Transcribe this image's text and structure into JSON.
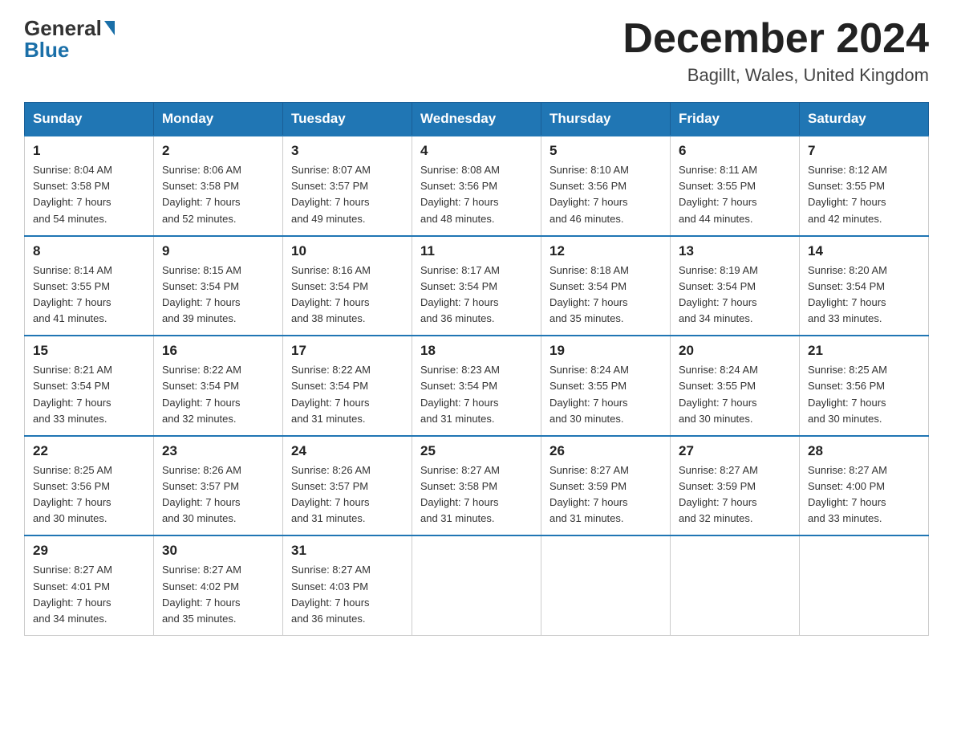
{
  "header": {
    "logo_general": "General",
    "logo_blue": "Blue",
    "title": "December 2024",
    "subtitle": "Bagillt, Wales, United Kingdom"
  },
  "weekdays": [
    "Sunday",
    "Monday",
    "Tuesday",
    "Wednesday",
    "Thursday",
    "Friday",
    "Saturday"
  ],
  "weeks": [
    [
      {
        "day": "1",
        "sunrise": "8:04 AM",
        "sunset": "3:58 PM",
        "daylight": "7 hours and 54 minutes."
      },
      {
        "day": "2",
        "sunrise": "8:06 AM",
        "sunset": "3:58 PM",
        "daylight": "7 hours and 52 minutes."
      },
      {
        "day": "3",
        "sunrise": "8:07 AM",
        "sunset": "3:57 PM",
        "daylight": "7 hours and 49 minutes."
      },
      {
        "day": "4",
        "sunrise": "8:08 AM",
        "sunset": "3:56 PM",
        "daylight": "7 hours and 48 minutes."
      },
      {
        "day": "5",
        "sunrise": "8:10 AM",
        "sunset": "3:56 PM",
        "daylight": "7 hours and 46 minutes."
      },
      {
        "day": "6",
        "sunrise": "8:11 AM",
        "sunset": "3:55 PM",
        "daylight": "7 hours and 44 minutes."
      },
      {
        "day": "7",
        "sunrise": "8:12 AM",
        "sunset": "3:55 PM",
        "daylight": "7 hours and 42 minutes."
      }
    ],
    [
      {
        "day": "8",
        "sunrise": "8:14 AM",
        "sunset": "3:55 PM",
        "daylight": "7 hours and 41 minutes."
      },
      {
        "day": "9",
        "sunrise": "8:15 AM",
        "sunset": "3:54 PM",
        "daylight": "7 hours and 39 minutes."
      },
      {
        "day": "10",
        "sunrise": "8:16 AM",
        "sunset": "3:54 PM",
        "daylight": "7 hours and 38 minutes."
      },
      {
        "day": "11",
        "sunrise": "8:17 AM",
        "sunset": "3:54 PM",
        "daylight": "7 hours and 36 minutes."
      },
      {
        "day": "12",
        "sunrise": "8:18 AM",
        "sunset": "3:54 PM",
        "daylight": "7 hours and 35 minutes."
      },
      {
        "day": "13",
        "sunrise": "8:19 AM",
        "sunset": "3:54 PM",
        "daylight": "7 hours and 34 minutes."
      },
      {
        "day": "14",
        "sunrise": "8:20 AM",
        "sunset": "3:54 PM",
        "daylight": "7 hours and 33 minutes."
      }
    ],
    [
      {
        "day": "15",
        "sunrise": "8:21 AM",
        "sunset": "3:54 PM",
        "daylight": "7 hours and 33 minutes."
      },
      {
        "day": "16",
        "sunrise": "8:22 AM",
        "sunset": "3:54 PM",
        "daylight": "7 hours and 32 minutes."
      },
      {
        "day": "17",
        "sunrise": "8:22 AM",
        "sunset": "3:54 PM",
        "daylight": "7 hours and 31 minutes."
      },
      {
        "day": "18",
        "sunrise": "8:23 AM",
        "sunset": "3:54 PM",
        "daylight": "7 hours and 31 minutes."
      },
      {
        "day": "19",
        "sunrise": "8:24 AM",
        "sunset": "3:55 PM",
        "daylight": "7 hours and 30 minutes."
      },
      {
        "day": "20",
        "sunrise": "8:24 AM",
        "sunset": "3:55 PM",
        "daylight": "7 hours and 30 minutes."
      },
      {
        "day": "21",
        "sunrise": "8:25 AM",
        "sunset": "3:56 PM",
        "daylight": "7 hours and 30 minutes."
      }
    ],
    [
      {
        "day": "22",
        "sunrise": "8:25 AM",
        "sunset": "3:56 PM",
        "daylight": "7 hours and 30 minutes."
      },
      {
        "day": "23",
        "sunrise": "8:26 AM",
        "sunset": "3:57 PM",
        "daylight": "7 hours and 30 minutes."
      },
      {
        "day": "24",
        "sunrise": "8:26 AM",
        "sunset": "3:57 PM",
        "daylight": "7 hours and 31 minutes."
      },
      {
        "day": "25",
        "sunrise": "8:27 AM",
        "sunset": "3:58 PM",
        "daylight": "7 hours and 31 minutes."
      },
      {
        "day": "26",
        "sunrise": "8:27 AM",
        "sunset": "3:59 PM",
        "daylight": "7 hours and 31 minutes."
      },
      {
        "day": "27",
        "sunrise": "8:27 AM",
        "sunset": "3:59 PM",
        "daylight": "7 hours and 32 minutes."
      },
      {
        "day": "28",
        "sunrise": "8:27 AM",
        "sunset": "4:00 PM",
        "daylight": "7 hours and 33 minutes."
      }
    ],
    [
      {
        "day": "29",
        "sunrise": "8:27 AM",
        "sunset": "4:01 PM",
        "daylight": "7 hours and 34 minutes."
      },
      {
        "day": "30",
        "sunrise": "8:27 AM",
        "sunset": "4:02 PM",
        "daylight": "7 hours and 35 minutes."
      },
      {
        "day": "31",
        "sunrise": "8:27 AM",
        "sunset": "4:03 PM",
        "daylight": "7 hours and 36 minutes."
      },
      null,
      null,
      null,
      null
    ]
  ],
  "labels": {
    "sunrise": "Sunrise:",
    "sunset": "Sunset:",
    "daylight": "Daylight:"
  }
}
